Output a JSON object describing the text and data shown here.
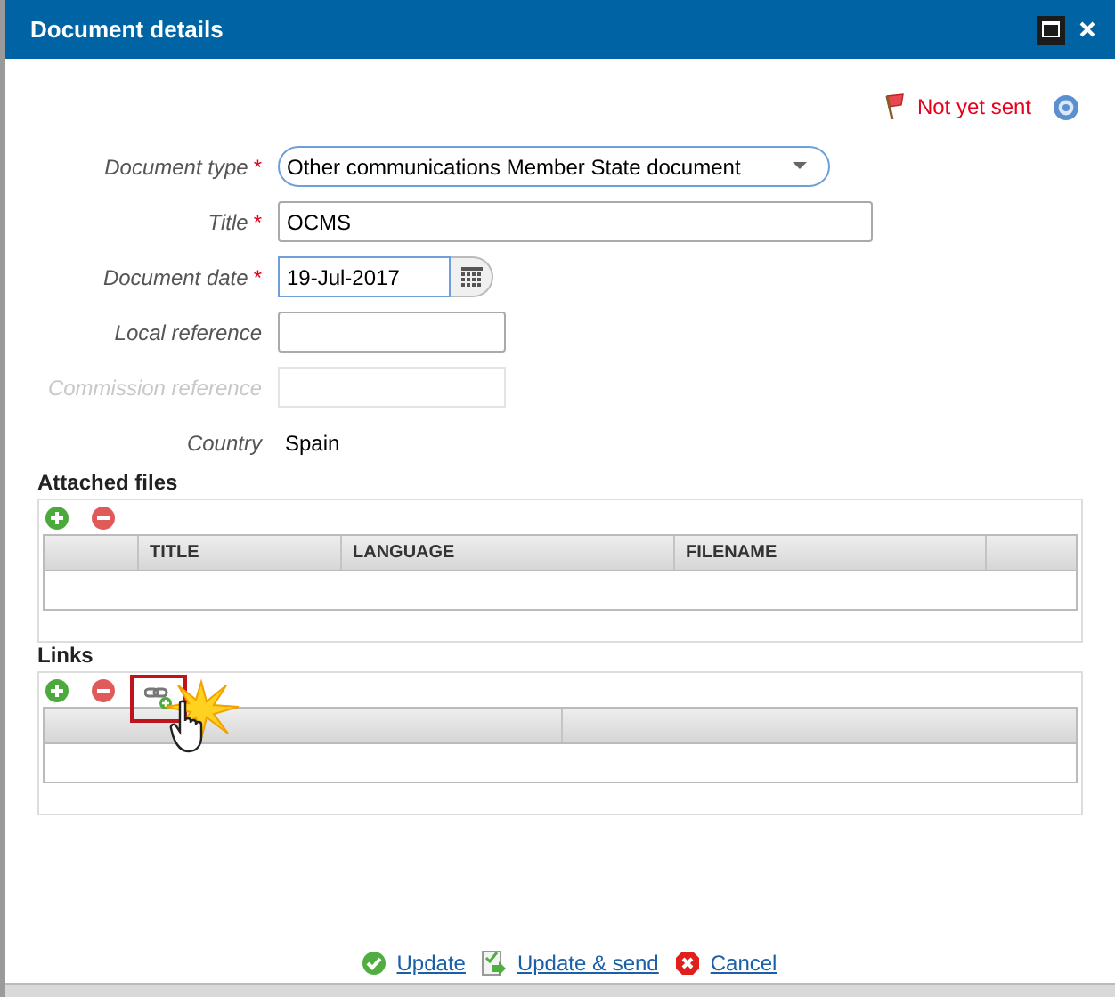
{
  "window": {
    "title": "Document details"
  },
  "status": {
    "text": "Not yet sent"
  },
  "fields": [
    {
      "kind": "select",
      "label": "Document type",
      "required_mark": "*",
      "value": "Other communications Member State document",
      "disabled": false
    },
    {
      "kind": "text",
      "label": "Title",
      "required_mark": "*",
      "value": "OCMS",
      "disabled": false
    },
    {
      "kind": "date",
      "label": "Document date",
      "required_mark": "*",
      "value": "19-Jul-2017",
      "disabled": false
    },
    {
      "kind": "text",
      "label": "Local reference",
      "disabled": false
    },
    {
      "kind": "text",
      "label": "Commission reference",
      "disabled": true
    },
    {
      "kind": "static",
      "label": "Country",
      "value": "Spain",
      "disabled": false
    }
  ],
  "attached_files": {
    "heading": "Attached files",
    "columns": [
      "TITLE",
      "LANGUAGE",
      "FILENAME"
    ]
  },
  "links": {
    "heading": "Links"
  },
  "footer": {
    "buttons": [
      {
        "kind": "update",
        "label": "Update"
      },
      {
        "kind": "send",
        "label": "Update & send"
      },
      {
        "kind": "cancel",
        "label": "Cancel"
      }
    ]
  }
}
